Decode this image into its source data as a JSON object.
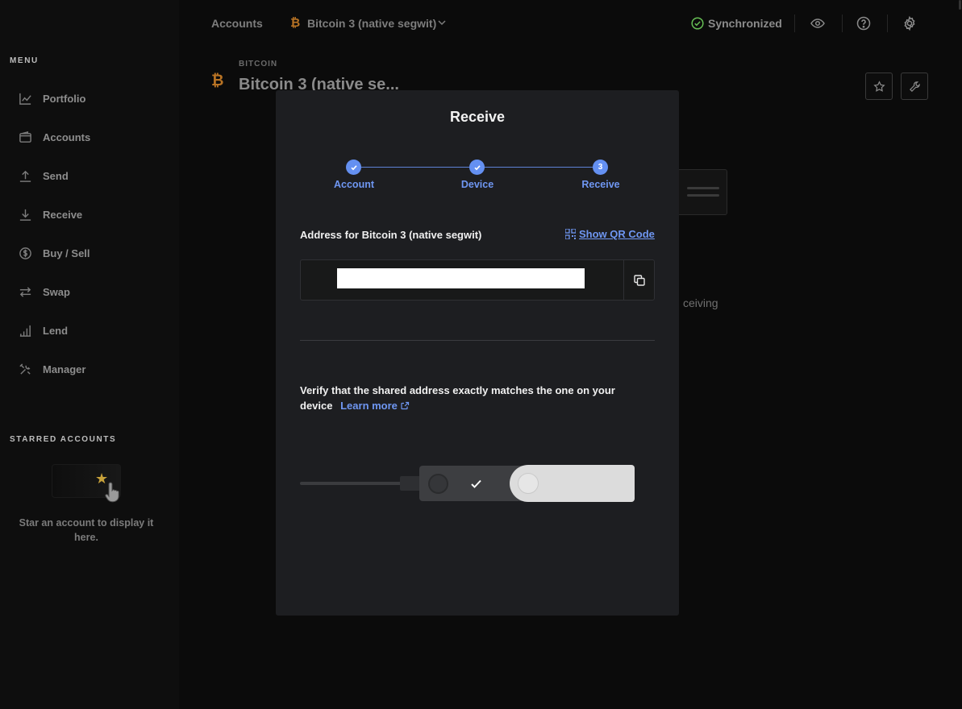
{
  "sidebar": {
    "menu_title": "MENU",
    "items": [
      {
        "label": "Portfolio",
        "icon": "chart-line-icon"
      },
      {
        "label": "Accounts",
        "icon": "wallet-icon"
      },
      {
        "label": "Send",
        "icon": "upload-arrow-icon"
      },
      {
        "label": "Receive",
        "icon": "download-arrow-icon"
      },
      {
        "label": "Buy / Sell",
        "icon": "dollar-circle-icon"
      },
      {
        "label": "Swap",
        "icon": "swap-arrows-icon"
      },
      {
        "label": "Lend",
        "icon": "bar-chart-icon"
      },
      {
        "label": "Manager",
        "icon": "tools-icon"
      }
    ],
    "starred_title": "STARRED ACCOUNTS",
    "starred_hint": "Star an account to display it here."
  },
  "topbar": {
    "accounts_label": "Accounts",
    "coin_symbol": "₿",
    "account_name": "Bitcoin 3 (native segwit)",
    "sync_status": "Synchronized"
  },
  "account_header": {
    "coin_label": "BITCOIN",
    "coin_symbol": "₿",
    "title": "Bitcoin 3 (native se..."
  },
  "background": {
    "receiving_fragment": "ceiving"
  },
  "modal": {
    "title": "Receive",
    "steps": [
      {
        "label": "Account",
        "state": "done"
      },
      {
        "label": "Device",
        "state": "done"
      },
      {
        "label": "Receive",
        "state": "active",
        "number": "3"
      }
    ],
    "address_label": "Address for Bitcoin 3 (native segwit)",
    "show_qr_label": "Show QR Code",
    "address_value": "",
    "verify_text": "Verify that the shared address exactly matches the one on your device",
    "learn_more_label": "Learn more"
  },
  "colors": {
    "accent": "#6490f1",
    "bitcoin": "#b87324",
    "sync_ok": "#66be54",
    "modal_bg": "#1d1e21"
  }
}
